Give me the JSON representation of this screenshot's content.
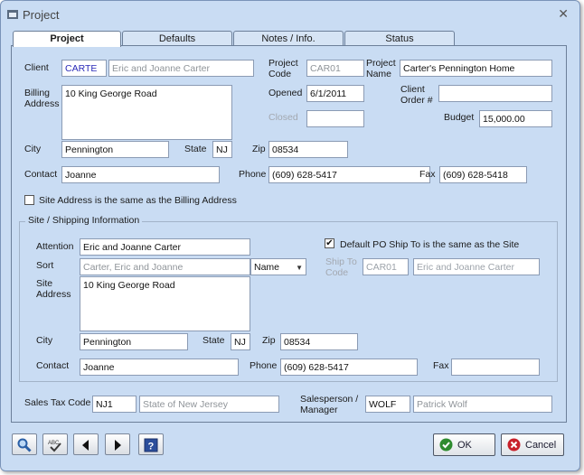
{
  "window": {
    "title": "Project"
  },
  "tabs": [
    {
      "label": "Project"
    },
    {
      "label": "Defaults"
    },
    {
      "label": "Notes / Info."
    },
    {
      "label": "Status"
    }
  ],
  "project": {
    "client_label": "Client",
    "client_code": "CARTE",
    "client_name": "Eric and Joanne Carter",
    "project_code_label": "Project Code",
    "project_code": "CAR01",
    "project_name_label": "Project Name",
    "project_name": "Carter's Pennington Home",
    "billing_address_label": "Billing Address",
    "billing_address": "10 King George Road",
    "opened_label": "Opened",
    "opened": "6/1/2011",
    "client_order_label": "Client Order #",
    "client_order": "",
    "closed_label": "Closed",
    "closed": "",
    "budget_label": "Budget",
    "budget": "15,000.00",
    "city_label": "City",
    "city": "Pennington",
    "state_label": "State",
    "state": "NJ",
    "zip_label": "Zip",
    "zip": "08534",
    "contact_label": "Contact",
    "contact": "Joanne",
    "phone_label": "Phone",
    "phone": "(609) 628-5417",
    "fax_label": "Fax",
    "fax": "(609) 628-5418",
    "same_as_billing_label": "Site Address is the same as the Billing Address",
    "same_as_billing_checked": false
  },
  "site": {
    "group_title": "Site / Shipping Information",
    "attention_label": "Attention",
    "attention": "Eric and Joanne Carter",
    "po_ship_label": "Default PO Ship To is the same as the Site",
    "po_ship_checked": true,
    "sort_label": "Sort",
    "sort": "Carter, Eric and Joanne",
    "sort_option": "Name",
    "ship_to_label": "Ship To Code",
    "ship_to_code": "CAR01",
    "ship_to_name": "Eric and Joanne Carter",
    "site_address_label": "Site Address",
    "site_address": "10 King George Road",
    "city_label": "City",
    "city": "Pennington",
    "state_label": "State",
    "state": "NJ",
    "zip_label": "Zip",
    "zip": "08534",
    "contact_label": "Contact",
    "contact": "Joanne",
    "phone_label": "Phone",
    "phone": "(609) 628-5417",
    "fax_label": "Fax",
    "fax": ""
  },
  "tax": {
    "label": "Sales Tax Code",
    "code": "NJ1",
    "name": "State of New Jersey"
  },
  "salesperson": {
    "label": "Salesperson / Manager",
    "code": "WOLF",
    "name": "Patrick Wolf"
  },
  "buttons": {
    "ok": "OK",
    "cancel": "Cancel"
  },
  "colors": {
    "window_bg": "#c9dcf3",
    "ok_green": "#2e8b2e",
    "cancel_red": "#c8202a",
    "help_blue": "#2b4e9c"
  }
}
